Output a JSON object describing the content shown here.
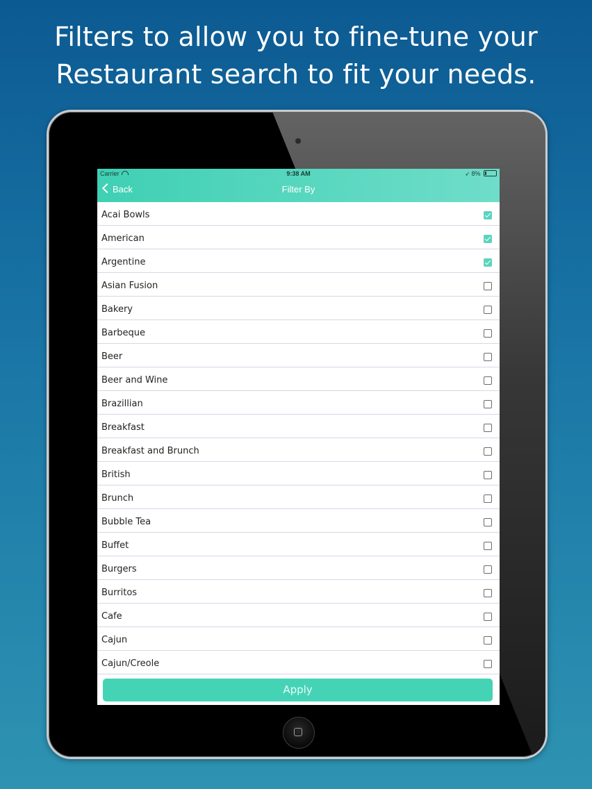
{
  "headline": {
    "line1": "Filters to allow you to fine-tune your",
    "line2": "Restaurant search to fit your needs."
  },
  "status_bar": {
    "carrier": "Carrier",
    "time": "9:38 AM",
    "battery": "8%"
  },
  "nav": {
    "back_label": "Back",
    "title": "Filter By"
  },
  "filters": [
    {
      "label": "Acai Bowls",
      "checked": true
    },
    {
      "label": "American",
      "checked": true
    },
    {
      "label": "Argentine",
      "checked": true
    },
    {
      "label": "Asian Fusion",
      "checked": false
    },
    {
      "label": "Bakery",
      "checked": false
    },
    {
      "label": "Barbeque",
      "checked": false
    },
    {
      "label": "Beer",
      "checked": false
    },
    {
      "label": "Beer and Wine",
      "checked": false
    },
    {
      "label": "Brazillian",
      "checked": false
    },
    {
      "label": "Breakfast",
      "checked": false
    },
    {
      "label": "Breakfast and Brunch",
      "checked": false
    },
    {
      "label": "British",
      "checked": false
    },
    {
      "label": "Brunch",
      "checked": false
    },
    {
      "label": "Bubble Tea",
      "checked": false
    },
    {
      "label": "Buffet",
      "checked": false
    },
    {
      "label": "Burgers",
      "checked": false
    },
    {
      "label": "Burritos",
      "checked": false
    },
    {
      "label": "Cafe",
      "checked": false
    },
    {
      "label": "Cajun",
      "checked": false
    },
    {
      "label": "Cajun/Creole",
      "checked": false
    }
  ],
  "apply_button": {
    "label": "Apply"
  },
  "colors": {
    "accent": "#45d3b6",
    "background_top": "#0c5a92",
    "background_bottom": "#2e93b2"
  },
  "icons": {
    "back": "chevron-left-icon",
    "wifi": "wifi-icon",
    "location": "location-arrow-icon",
    "battery": "battery-icon",
    "home": "home-button-icon"
  }
}
